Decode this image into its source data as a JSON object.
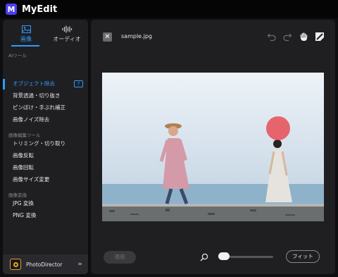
{
  "app": {
    "title": "MyEdit",
    "logo_letter": "M"
  },
  "tabs": [
    {
      "label": "画像",
      "icon": "image-icon",
      "active": true
    },
    {
      "label": "オーディオ",
      "icon": "audio-wave-icon",
      "active": false
    }
  ],
  "sidebar": {
    "sections": [
      {
        "title": "AIツール",
        "items": [
          "オブジェクト除去",
          "背景透過・切り抜き",
          "ピンぼけ・手ぶれ補正",
          "画像ノイズ除去"
        ]
      },
      {
        "title": "画像編集ツール",
        "items": [
          "トリミング・切り取り",
          "画像反転",
          "画像回転",
          "画像サイズ変更"
        ]
      },
      {
        "title": "画像変換",
        "items": [
          "JPG 変換",
          "PNG 変換"
        ]
      }
    ],
    "active_item": "オブジェクト除去",
    "promo": {
      "label": "PhotoDirector",
      "icon": "photodirector-icon"
    }
  },
  "editor": {
    "filename": "sample.jpg",
    "tools": [
      "undo-icon",
      "redo-icon",
      "hand-icon",
      "eraser-icon"
    ],
    "apply_label": "適用",
    "fit_label": "フィット",
    "zoom_level": 0.1
  },
  "colors": {
    "accent": "#2f9bff",
    "brush": "#e8434b",
    "panel": "#1f1f22"
  }
}
